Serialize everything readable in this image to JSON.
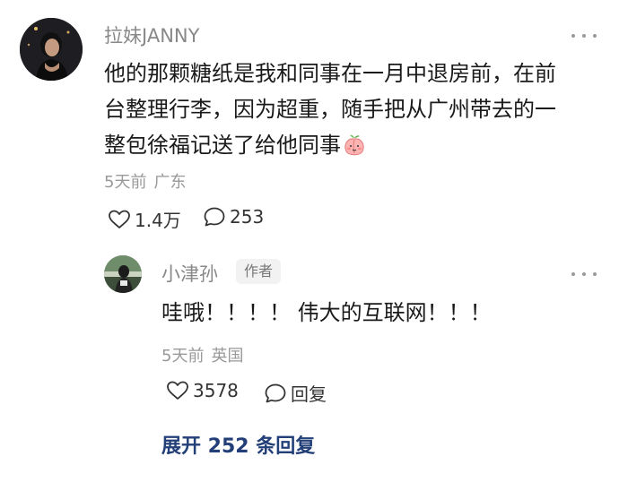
{
  "comment": {
    "username": "拉妹JANNY",
    "lines": [
      "他的那颗糖纸是我和同事在一月中退房前，在前",
      "台整理行李，因为超重，随手把从广州带去的一",
      "整包徐福记送了给他同事"
    ],
    "time": "5天前",
    "location": "广东",
    "like_count": "1.4万",
    "reply_count": "253",
    "emoji": "peach-emoji"
  },
  "reply": {
    "username": "小津孙",
    "badge": "作者",
    "text": "哇哦！！！！ 伟大的互联网！！！",
    "time": "5天前",
    "location": "英国",
    "like_count": "3578",
    "reply_label": "回复"
  },
  "expand": {
    "label": "展开 252 条回复"
  },
  "icons": {
    "more": "more-dots-icon",
    "like": "heart-outline-icon",
    "comment": "speech-bubble-icon"
  },
  "colors": {
    "username": "#888888",
    "text": "#1a1a1a",
    "meta": "#999999",
    "link": "#233f78",
    "badge_bg": "#f2f2f2"
  }
}
